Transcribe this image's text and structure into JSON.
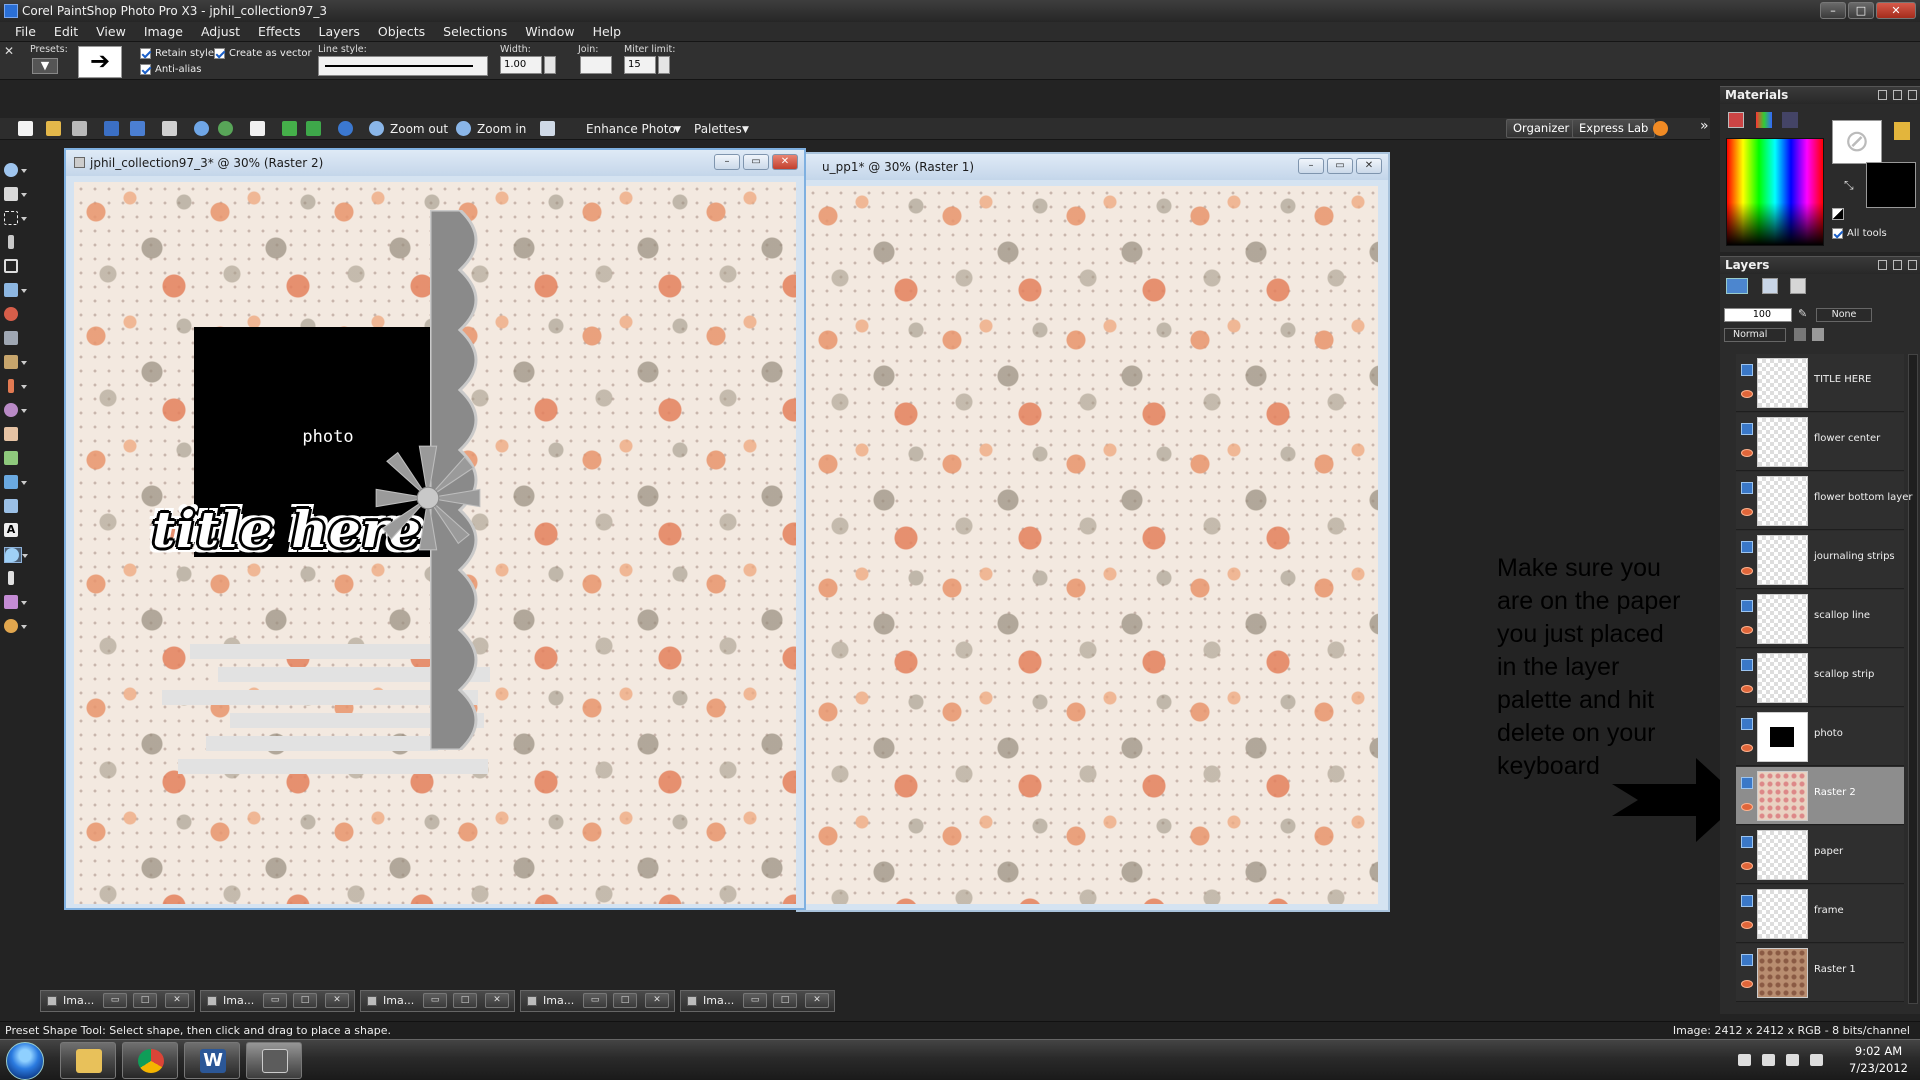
{
  "app": {
    "title": "Corel PaintShop Photo Pro X3 - jphil_collection97_3",
    "window_buttons": [
      "–",
      "□",
      "✕"
    ]
  },
  "menu": [
    "File",
    "Edit",
    "View",
    "Image",
    "Adjust",
    "Effects",
    "Layers",
    "Objects",
    "Selections",
    "Window",
    "Help"
  ],
  "options": {
    "presets_label": "Presets:",
    "retain_style": "Retain style",
    "create_as_vector": "Create as vector",
    "anti_alias": "Anti-alias",
    "line_style_label": "Line style:",
    "width_label": "Width:",
    "width_value": "1.00",
    "join_label": "Join:",
    "miter_label": "Miter limit:",
    "miter_value": "15"
  },
  "toolbar": {
    "zoom_out": "Zoom out",
    "zoom_in": "Zoom in",
    "enhance_photo": "Enhance Photo",
    "palettes": "Palettes",
    "organizer": "Organizer",
    "express_lab": "Express Lab",
    "expand": "»"
  },
  "documents": [
    {
      "title": "jphil_collection97_3* @  30% (Raster 2)"
    },
    {
      "title": "u_pp1* @  30% (Raster 1)"
    }
  ],
  "canvas": {
    "photo_label": "photo",
    "title_art": "title here"
  },
  "minimized": [
    {
      "label": "Ima..."
    },
    {
      "label": "Ima..."
    },
    {
      "label": "Ima..."
    },
    {
      "label": "Ima..."
    },
    {
      "label": "Ima..."
    }
  ],
  "status": {
    "left": "Preset Shape Tool: Select shape, then click and drag to place a shape.",
    "right": "Image:  2412 x 2412 x RGB - 8 bits/channel"
  },
  "clock": {
    "time": "9:02 AM",
    "date": "7/23/2012"
  },
  "materials": {
    "title": "Materials",
    "all_tools": "All tools"
  },
  "layers": {
    "title": "Layers",
    "opacity": "100",
    "blend_mode": "Normal",
    "mask": "None",
    "items": [
      {
        "name": "TITLE HERE",
        "selected": false
      },
      {
        "name": "flower center",
        "selected": false
      },
      {
        "name": "flower bottom layer",
        "selected": false
      },
      {
        "name": "journaling strips",
        "selected": false
      },
      {
        "name": "scallop line",
        "selected": false
      },
      {
        "name": "scallop strip",
        "selected": false
      },
      {
        "name": "photo",
        "selected": false
      },
      {
        "name": "Raster 2",
        "selected": true
      },
      {
        "name": "paper",
        "selected": false
      },
      {
        "name": "frame",
        "selected": false
      },
      {
        "name": "Raster 1",
        "selected": false
      }
    ]
  },
  "instruction": "Make sure you are on the paper you just placed in the layer palette and hit delete on your keyboard",
  "colors": {
    "accent_blue": "#2a6fd6",
    "paper_bg": "#f3e9e0",
    "rose": "#e8946c",
    "selected_layer": "#8d8d8d"
  }
}
